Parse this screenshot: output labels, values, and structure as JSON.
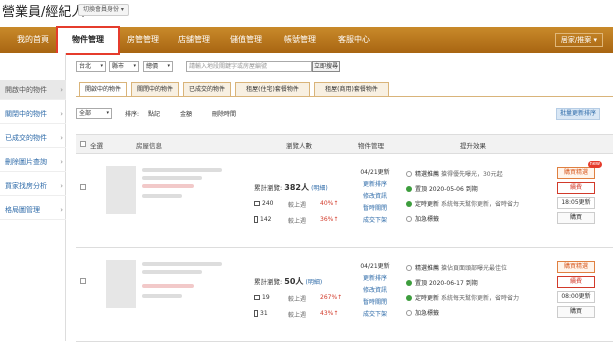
{
  "header": {
    "brand": "營業員/經紀人",
    "switch_label": "切換會員身份"
  },
  "nav": {
    "items": [
      "我的首頁",
      "物件管理",
      "房管管理",
      "店舖管理",
      "儲值管理",
      "帳號管理",
      "客服中心"
    ],
    "active_index": 1,
    "user_menu": "居家/推案"
  },
  "sidebar": {
    "items": [
      "開啟中的物件",
      "關閉中的物件",
      "已成交的物件",
      "刪除圖片查詢",
      "買家找房分析",
      "格局圖管理"
    ],
    "active_index": 0
  },
  "filters": {
    "city": "台北",
    "district": "縣市",
    "type": "總價",
    "search_placeholder": "請輸入地段關鍵字或房屋編號",
    "search_button": "立即搜尋"
  },
  "tabs": [
    "開啟中的物件",
    "關閉中的物件",
    "已成交的物件",
    "租屋(住宅)套餐物件",
    "租屋(商用)套餐物件"
  ],
  "sort": {
    "scope": "全部",
    "label": "排序:",
    "options": [
      "點記",
      "金額",
      "刪除時間"
    ],
    "bulk_button": "批量更新排序"
  },
  "table": {
    "select_all": "全選",
    "headers": [
      "房屋信息",
      "瀏覽人數",
      "物件管理",
      "提升效果"
    ]
  },
  "rows": [
    {
      "total_label": "累計瀏覽:",
      "total": "382人",
      "detail": "(明細)",
      "pc": "240",
      "pc_label": "較上週",
      "pc_pct": "40%↑",
      "mobile": "142",
      "mobile_label": "較上週",
      "mobile_pct": "36%↑",
      "date": "04/21更新",
      "actions": [
        "更新排序",
        "修改資訊",
        "暫時關閉",
        "成交下架"
      ],
      "effects": [
        {
          "text": "精選推薦",
          "note": "搶得優先曝光，30元起",
          "on": false
        },
        {
          "text": "置頂",
          "note": "2020-05-06 到期",
          "on": true
        },
        {
          "text": "定時更新",
          "note": "系統每天幫你更新，省時省力",
          "on": true
        },
        {
          "text": "加急標籤",
          "note": "",
          "on": false
        }
      ],
      "buttons": [
        "購買精選",
        "續費",
        "18:05更新",
        "購買"
      ],
      "badge": "new"
    },
    {
      "total_label": "累計瀏覽:",
      "total": "50人",
      "detail": "(明細)",
      "pc": "19",
      "pc_label": "較上週",
      "pc_pct": "267%↑",
      "mobile": "31",
      "mobile_label": "較上週",
      "mobile_pct": "43%↑",
      "date": "04/21更新",
      "actions": [
        "更新排序",
        "修改資訊",
        "暫時關閉",
        "成交下架"
      ],
      "effects": [
        {
          "text": "精選推薦",
          "note": "搶佔頁面頭部曝光最佳位",
          "on": false
        },
        {
          "text": "置頂",
          "note": "2020-06-17 到期",
          "on": true
        },
        {
          "text": "定時更新",
          "note": "系統每天幫你更新，省時省力",
          "on": true
        },
        {
          "text": "加急標籤",
          "note": "",
          "on": false
        }
      ],
      "buttons": [
        "購買精選",
        "續費",
        "08:00更新",
        "購買"
      ],
      "badge": ""
    }
  ]
}
